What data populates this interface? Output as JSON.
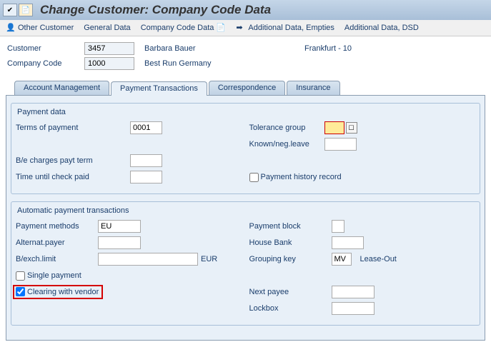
{
  "header": {
    "title": "Change Customer: Company Code Data"
  },
  "toolbar": {
    "other_customer": "Other Customer",
    "general_data": "General Data",
    "company_code_data": "Company Code Data",
    "additional_data_empties": "Additional Data, Empties",
    "additional_data_dsd": "Additional Data, DSD"
  },
  "info": {
    "customer_label": "Customer",
    "customer_value": "3457",
    "customer_name": "Barbara Bauer",
    "customer_city": "Frankfurt - 10",
    "company_code_label": "Company Code",
    "company_code_value": "1000",
    "company_code_name": "Best Run Germany"
  },
  "tabs": {
    "account_management": "Account Management",
    "payment_transactions": "Payment Transactions",
    "correspondence": "Correspondence",
    "insurance": "Insurance"
  },
  "payment_data": {
    "title": "Payment data",
    "terms_of_payment_label": "Terms of payment",
    "terms_of_payment_value": "0001",
    "be_charges_label": "B/e charges payt term",
    "time_until_check_label": "Time until check paid",
    "tolerance_group_label": "Tolerance group",
    "tolerance_group_value": "",
    "known_neg_leave_label": "Known/neg.leave",
    "payment_history_label": "Payment history record"
  },
  "auto_payment": {
    "title": "Automatic payment transactions",
    "payment_methods_label": "Payment methods",
    "payment_methods_value": "EU",
    "alternat_payer_label": "Alternat.payer",
    "bexch_limit_label": "B/exch.limit",
    "bexch_currency": "EUR",
    "single_payment_label": "Single payment",
    "clearing_with_vendor_label": "Clearing with vendor",
    "payment_block_label": "Payment block",
    "house_bank_label": "House Bank",
    "grouping_key_label": "Grouping key",
    "grouping_key_value": "MV",
    "lease_out_label": "Lease-Out",
    "next_payee_label": "Next payee",
    "lockbox_label": "Lockbox"
  }
}
